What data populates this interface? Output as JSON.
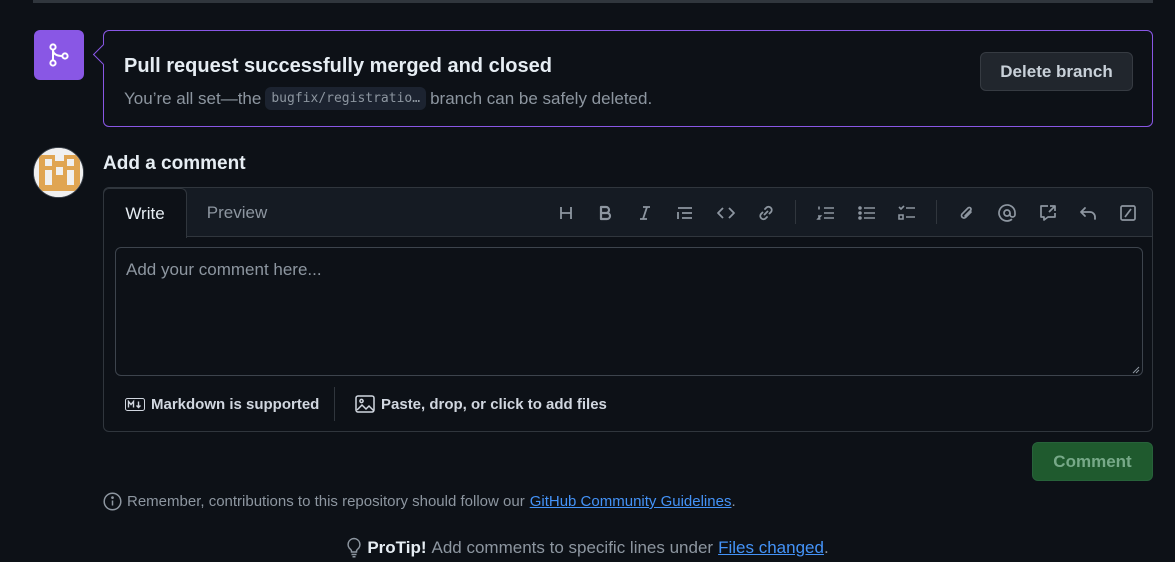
{
  "merge": {
    "title": "Pull request successfully merged and closed",
    "sub_prefix": "You’re all set—the",
    "branch": "bugfix/registratio…",
    "sub_suffix": "branch can be safely deleted.",
    "delete_label": "Delete branch",
    "icon": "git-merge-icon"
  },
  "comment": {
    "heading": "Add a comment",
    "tabs": {
      "write": "Write",
      "preview": "Preview"
    },
    "placeholder": "Add your comment here...",
    "toolbar_icons": [
      "heading-icon",
      "bold-icon",
      "italic-icon",
      "quote-icon",
      "code-icon",
      "link-icon",
      "ordered-list-icon",
      "unordered-list-icon",
      "task-list-icon",
      "attach-icon",
      "mention-icon",
      "reference-icon",
      "reply-icon",
      "slash-command-icon"
    ],
    "markdown_label": "Markdown is supported",
    "attach_label": "Paste, drop, or click to add files",
    "submit_label": "Comment"
  },
  "notice": {
    "text": "Remember, contributions to this repository should follow our",
    "link": "GitHub Community Guidelines",
    "end": "."
  },
  "protip": {
    "label": "ProTip!",
    "text": "Add comments to specific lines under",
    "link": "Files changed",
    "end": "."
  },
  "colors": {
    "background": "#0d1117",
    "merged_purple": "#8957e5",
    "link_blue": "#4493f8",
    "comment_green": "#1f5a2e"
  }
}
